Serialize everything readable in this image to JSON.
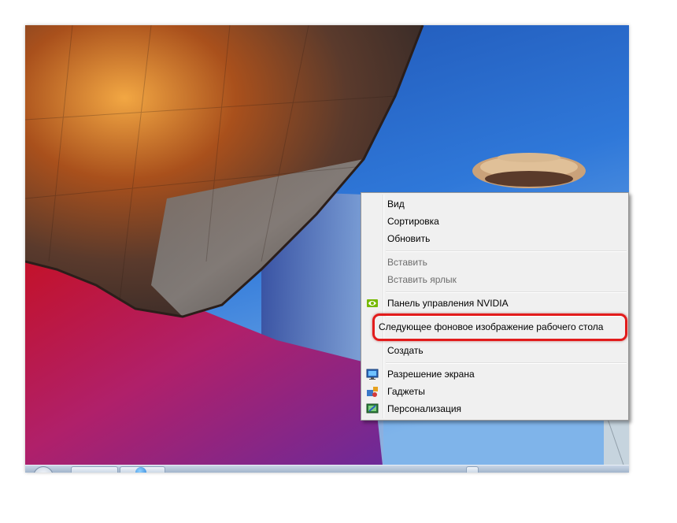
{
  "context_menu": {
    "items": [
      {
        "label": "Вид",
        "enabled": true
      },
      {
        "label": "Сортировка",
        "enabled": true
      },
      {
        "label": "Обновить",
        "enabled": true
      },
      {
        "label": "Вставить",
        "enabled": false
      },
      {
        "label": "Вставить ярлык",
        "enabled": false
      },
      {
        "label": "Панель управления NVIDIA",
        "enabled": true,
        "icon": "nvidia-icon"
      },
      {
        "label": "Следующее фоновое изображение рабочего стола",
        "enabled": true,
        "highlighted": true
      },
      {
        "label": "Создать",
        "enabled": true
      },
      {
        "label": "Разрешение экрана",
        "enabled": true,
        "icon": "display-icon"
      },
      {
        "label": "Гаджеты",
        "enabled": true,
        "icon": "gadgets-icon"
      },
      {
        "label": "Персонализация",
        "enabled": true,
        "icon": "personalization-icon"
      }
    ]
  },
  "colors": {
    "highlight_ring": "#e21b1b",
    "menu_background": "#f0f0f0",
    "nvidia_green": "#76b900"
  }
}
